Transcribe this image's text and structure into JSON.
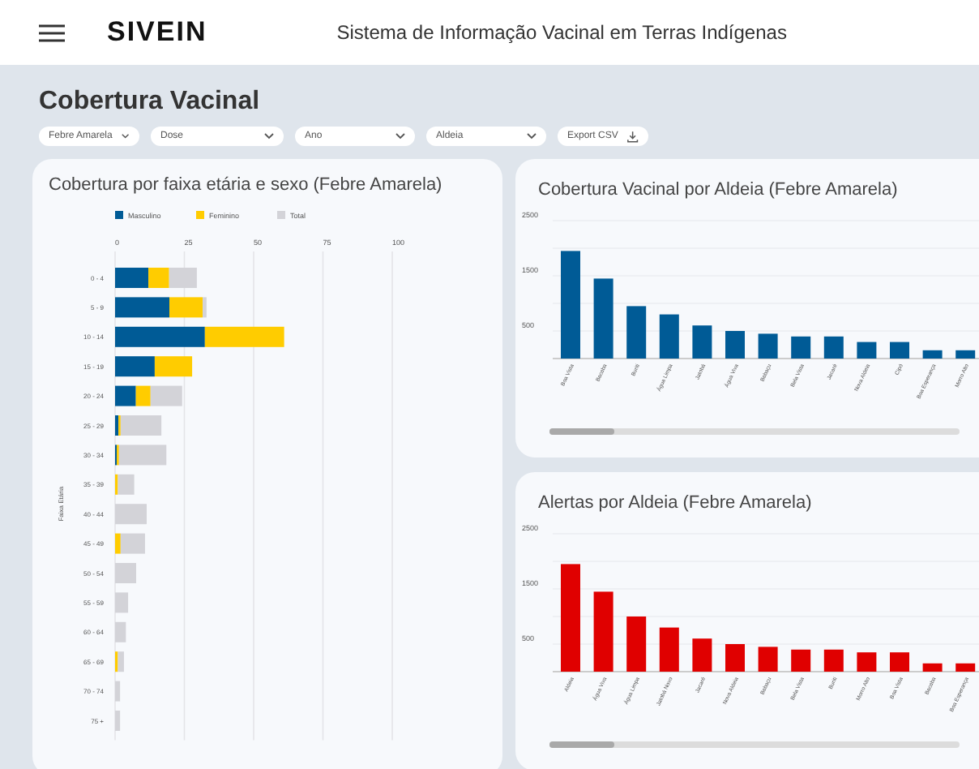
{
  "header": {
    "brand": "SIVEIN",
    "title": "Sistema de Informação Vacinal em Terras Indígenas"
  },
  "page_title": "Cobertura Vacinal",
  "filters": [
    {
      "label": "Febre Amarela",
      "kind": "select"
    },
    {
      "label": "Dose",
      "kind": "select"
    },
    {
      "label": "Ano",
      "kind": "select"
    },
    {
      "label": "Aldeia",
      "kind": "select"
    },
    {
      "label": "Export CSV",
      "kind": "export"
    }
  ],
  "age_chart": {
    "title": "Cobertura por faixa etária e sexo (Febre Amarela)",
    "chart_data": {
      "type": "bar",
      "orientation": "horizontal",
      "stacked": true,
      "grid": true,
      "legend": true,
      "ylabel": "Faixa Etária",
      "categories": [
        "0 - 4",
        "5 - 9",
        "10 - 14",
        "15 - 19",
        "20 - 24",
        "25 - 29",
        "30 - 34",
        "35 - 39",
        "40 - 44",
        "45 - 49",
        "50 - 54",
        "55 - 59",
        "60 - 64",
        "65 - 69",
        "70 - 74",
        "75 +"
      ],
      "xlim": [
        0,
        100
      ],
      "xticks": [
        0,
        25,
        50,
        75,
        100
      ],
      "series": [
        {
          "name": "Masculino",
          "color": "#005b96",
          "values": [
            12,
            19.6,
            32.4,
            14.3,
            7.5,
            1.2,
            0.6,
            0,
            0,
            0,
            0,
            0,
            0,
            0,
            0,
            0
          ]
        },
        {
          "name": "Feminino",
          "color": "#ffcc00",
          "values": [
            7.5,
            12,
            28.6,
            13.5,
            5.3,
            0.8,
            0.8,
            1,
            0,
            2,
            0,
            0,
            0,
            1,
            0,
            0
          ]
        },
        {
          "name": "Total",
          "color": "#d3d3d8",
          "values": [
            10,
            1.4,
            0,
            0,
            11.4,
            14.7,
            17.1,
            5.9,
            11.4,
            8.8,
            7.6,
            4.7,
            3.9,
            2.2,
            1.8,
            1.8
          ]
        }
      ]
    }
  },
  "village_charts": [
    {
      "title": "Cobertura Vacinal por Aldeia (Febre Amarela)",
      "chart_data": {
        "type": "bar",
        "ylim": [
          0,
          2500
        ],
        "yticks": [
          500,
          1500,
          2500
        ],
        "categories": [
          "Boa Vista",
          "Bacaba",
          "Buriti",
          "Água Limpa",
          "Jatobá",
          "Água Viva",
          "Babaçu",
          "Bela Vista",
          "Jacaré",
          "Nova Aldeia",
          "Cipó",
          "Boa Esperança",
          "Morro Alto"
        ],
        "series": [
          {
            "color": "#005b96",
            "values": [
              1950,
              1450,
              950,
              800,
              600,
              500,
              450,
              400,
              400,
              300,
              300,
              150,
              150
            ]
          }
        ]
      }
    },
    {
      "title": "Alertas por Aldeia (Febre Amarela)",
      "chart_data": {
        "type": "bar",
        "ylim": [
          0,
          2500
        ],
        "yticks": [
          500,
          1500,
          2500
        ],
        "categories": [
          "Aldeia",
          "Água Viva",
          "Água Limpa",
          "Jatobá Novo",
          "Jacaré",
          "Nova Aldeia",
          "Babaçu",
          "Bela Vista",
          "Buriti",
          "Morro Alto",
          "Boa Vista",
          "Bacaba",
          "Boa Esperança"
        ],
        "series": [
          {
            "color": "#e00000",
            "values": [
              1950,
              1450,
              1000,
              800,
              600,
              500,
              450,
              400,
              400,
              350,
              350,
              150,
              150
            ]
          }
        ]
      }
    }
  ]
}
